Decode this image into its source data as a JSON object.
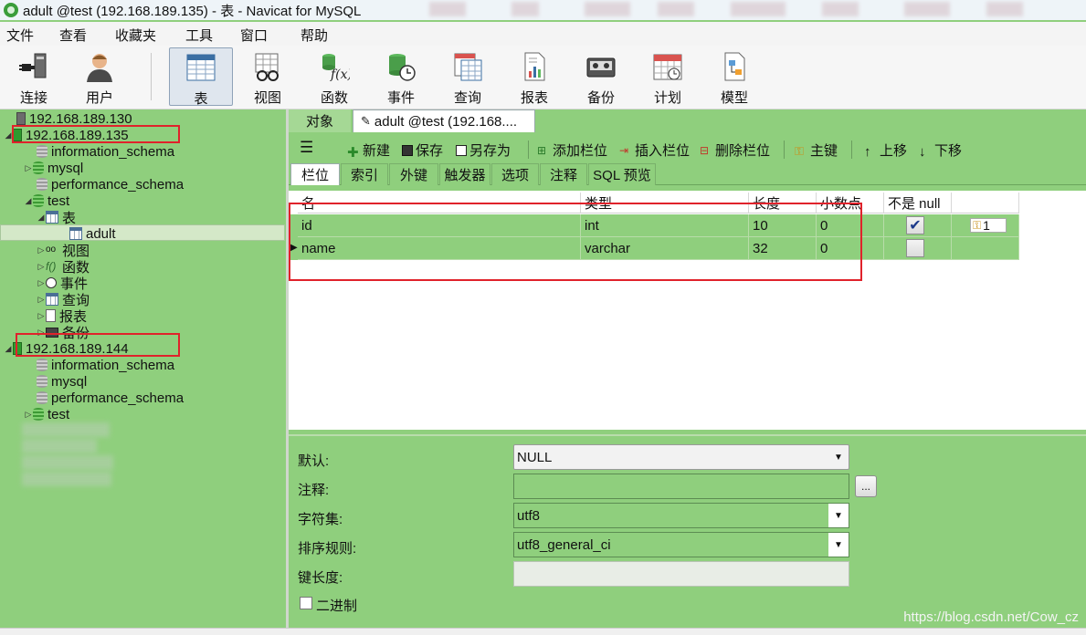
{
  "window": {
    "title": "adult @test (192.168.189.135) - 表 - Navicat for MySQL"
  },
  "menu": [
    "文件",
    "查看",
    "收藏夹",
    "工具",
    "窗口",
    "帮助"
  ],
  "toolbar": {
    "buttons": [
      "连接",
      "用户",
      "表",
      "视图",
      "函数",
      "事件",
      "查询",
      "报表",
      "备份",
      "计划",
      "模型"
    ],
    "active": "表"
  },
  "tree": {
    "server1": "192.168.189.130",
    "server2": "192.168.189.135",
    "server2_dbs": [
      "information_schema",
      "mysql",
      "performance_schema",
      "test"
    ],
    "tables_node": "表",
    "selected_table": "adult",
    "other_nodes": [
      "视图",
      "函数",
      "事件",
      "查询",
      "报表",
      "备份"
    ],
    "server3": "192.168.189.144",
    "server3_dbs": [
      "information_schema",
      "mysql",
      "performance_schema",
      "test"
    ]
  },
  "tabs": {
    "objects": "对象",
    "active": "adult @test (192.168...."
  },
  "designer_toolbar": [
    "新建",
    "保存",
    "另存为",
    "添加栏位",
    "插入栏位",
    "删除栏位",
    "主键",
    "上移",
    "下移"
  ],
  "subtabs": [
    "栏位",
    "索引",
    "外键",
    "触发器",
    "选项",
    "注释",
    "SQL 预览"
  ],
  "grid": {
    "headers": [
      "名",
      "类型",
      "长度",
      "小数点",
      "不是 null",
      ""
    ],
    "rows": [
      {
        "name": "id",
        "type": "int",
        "length": "10",
        "decimals": "0",
        "not_null": true,
        "key": "1"
      },
      {
        "name": "name",
        "type": "varchar",
        "length": "32",
        "decimals": "0",
        "not_null": false,
        "key": ""
      }
    ]
  },
  "props": {
    "default_label": "默认:",
    "default_value": "NULL",
    "comment_label": "注释:",
    "comment_btn": "...",
    "charset_label": "字符集:",
    "charset_value": "utf8",
    "collation_label": "排序规则:",
    "collation_value": "utf8_general_ci",
    "keylen_label": "键长度:",
    "binary_label": "二进制"
  },
  "watermark": "https://blog.csdn.net/Cow_cz"
}
